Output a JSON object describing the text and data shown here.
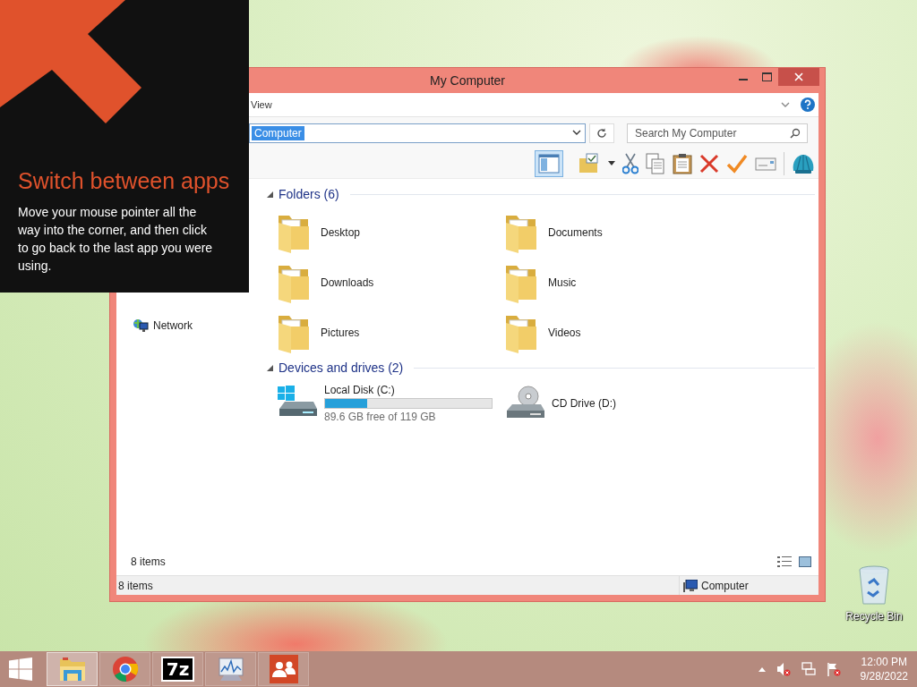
{
  "window": {
    "title": "My Computer"
  },
  "ribbon": {
    "tab": "View"
  },
  "address": {
    "value": "Computer"
  },
  "search": {
    "placeholder": "Search My Computer"
  },
  "toolbar": {
    "preview_pane_on": true
  },
  "navigation": {
    "items": [
      {
        "label": "Network"
      }
    ]
  },
  "folders": {
    "title": "Folders (6)",
    "items": [
      {
        "name": "Desktop"
      },
      {
        "name": "Documents"
      },
      {
        "name": "Downloads"
      },
      {
        "name": "Music"
      },
      {
        "name": "Pictures"
      },
      {
        "name": "Videos"
      }
    ]
  },
  "devices": {
    "title": "Devices and drives (2)",
    "drives": [
      {
        "kind": "disk",
        "name": "Local Disk (C:)",
        "level": 0.25,
        "free": "89.6 GB free of 119 GB"
      },
      {
        "kind": "cd",
        "name": "CD Drive (D:)"
      }
    ]
  },
  "item_count": "8 items",
  "status_bar": {
    "count": "8 items",
    "location": "Computer"
  },
  "tip": {
    "title": "Switch between apps",
    "text": "Move your mouse pointer all the way into the corner, and then click to go back to the last app you were using."
  },
  "desktop_icons": [
    {
      "label": "Recycle Bin"
    }
  ],
  "taskbar": {
    "apps": [
      {
        "kind": "explorer",
        "selected": true
      },
      {
        "kind": "chrome",
        "selected": false
      },
      {
        "kind": "archiver",
        "label": "7z",
        "selected": false
      },
      {
        "kind": "monitor",
        "selected": false
      },
      {
        "kind": "people",
        "selected": false
      }
    ],
    "clock": {
      "time": "12:00 PM",
      "date": "9/28/2022"
    }
  }
}
